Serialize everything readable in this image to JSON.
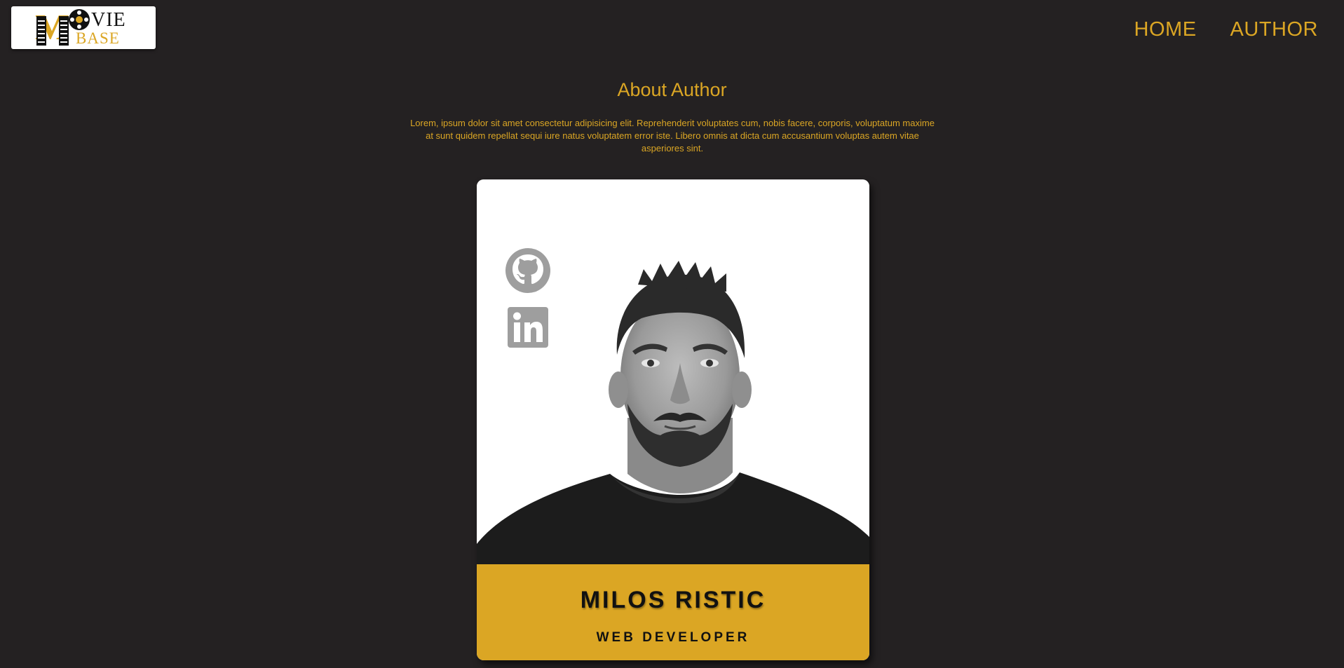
{
  "header": {
    "logo": {
      "line1": "VIE",
      "line2": "BASE",
      "initial": "M"
    },
    "nav": [
      {
        "label": "HOME"
      },
      {
        "label": "AUTHOR"
      }
    ]
  },
  "about": {
    "title": "About Author",
    "text": "Lorem, ipsum dolor sit amet consectetur adipisicing elit. Reprehenderit voluptates cum, nobis facere, corporis, voluptatum maxime at sunt quidem repellat sequi iure natus voluptatem error iste. Libero omnis at dicta cum accusantium voluptas autem vitae asperiores sint."
  },
  "card": {
    "name": "MILOS RISTIC",
    "role": "WEB DEVELOPER",
    "social": [
      {
        "icon": "github-icon"
      },
      {
        "icon": "linkedin-icon"
      }
    ]
  },
  "colors": {
    "background": "#242122",
    "accent": "#dba624",
    "card": "#ffffff",
    "icon_gray": "#9e9e9e"
  }
}
